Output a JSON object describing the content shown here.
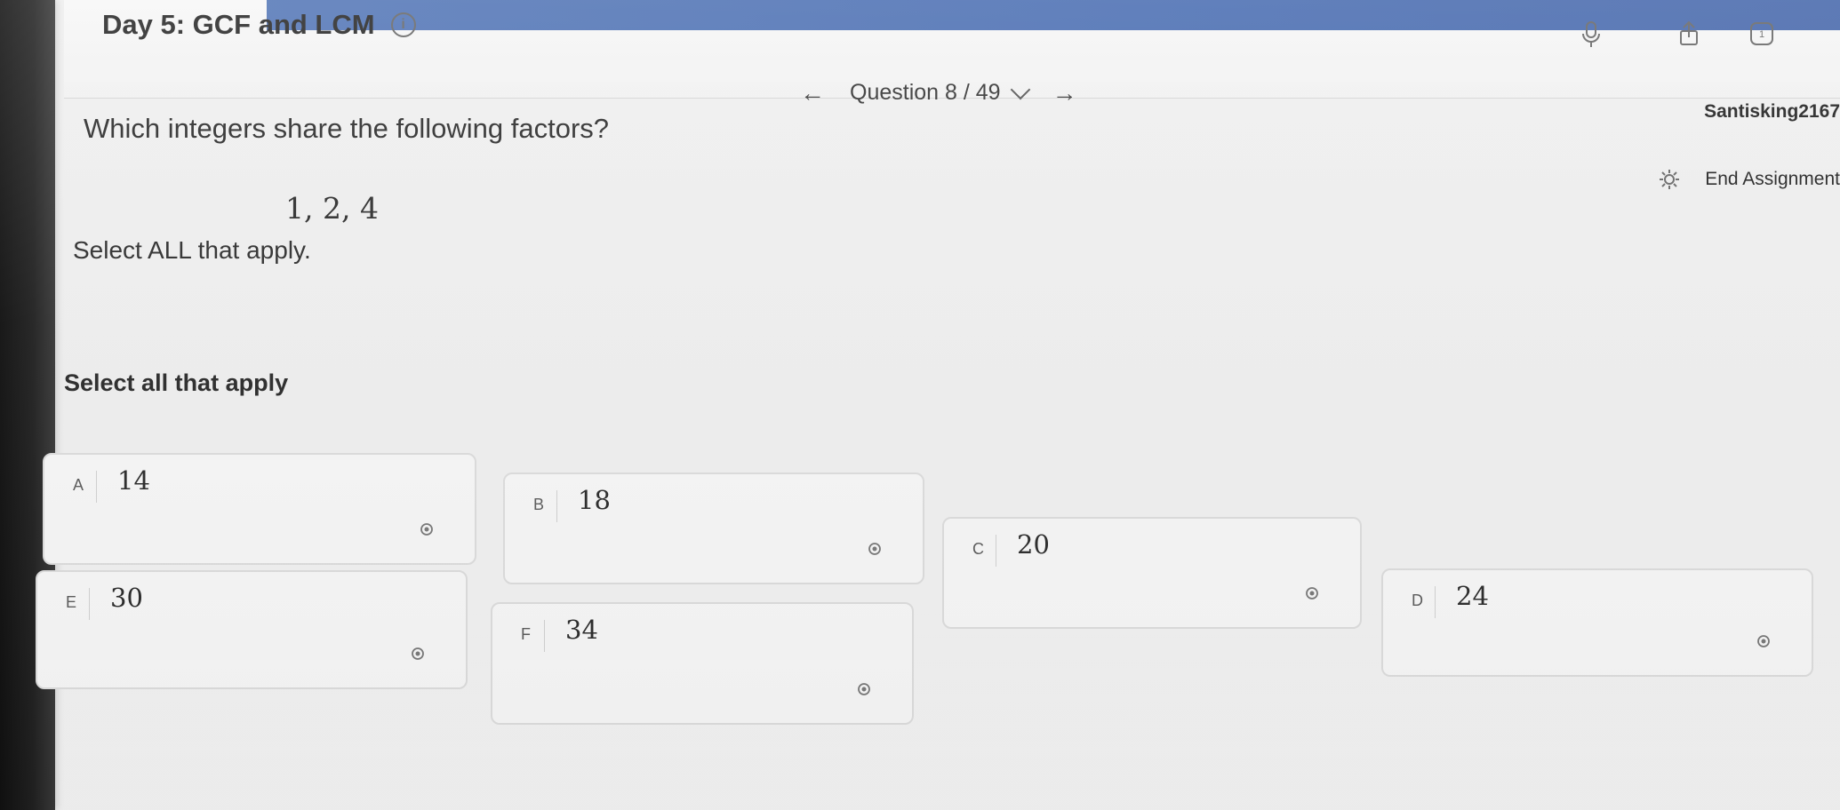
{
  "header": {
    "title": "Day 5: GCF and LCM",
    "question_label": "Question 8 / 49",
    "user_name": "Santisking2167",
    "end_assignment_label": "End Assignment",
    "notification_count": "1"
  },
  "question": {
    "prompt": "Which integers share the following factors?",
    "factors": "1, 2, 4",
    "instruction": "Select ALL that apply.",
    "subhead": "Select all that apply"
  },
  "options": [
    {
      "letter": "A",
      "value": "14"
    },
    {
      "letter": "B",
      "value": "18"
    },
    {
      "letter": "C",
      "value": "20"
    },
    {
      "letter": "D",
      "value": "24"
    },
    {
      "letter": "E",
      "value": "30"
    },
    {
      "letter": "F",
      "value": "34"
    }
  ],
  "icons": {
    "info": "info-icon",
    "back_arrow": "arrow-left-icon",
    "forward_arrow": "arrow-right-icon",
    "dropdown": "chevron-down-icon",
    "microphone": "microphone-icon",
    "share": "share-icon",
    "notifications": "notification-icon",
    "settings": "gear-icon",
    "eliminate": "eye-off-icon"
  },
  "colors": {
    "header_blue": "#3e64ad",
    "text_primary": "#2a2a2a",
    "card_border": "#dadada",
    "background": "#efefef"
  }
}
